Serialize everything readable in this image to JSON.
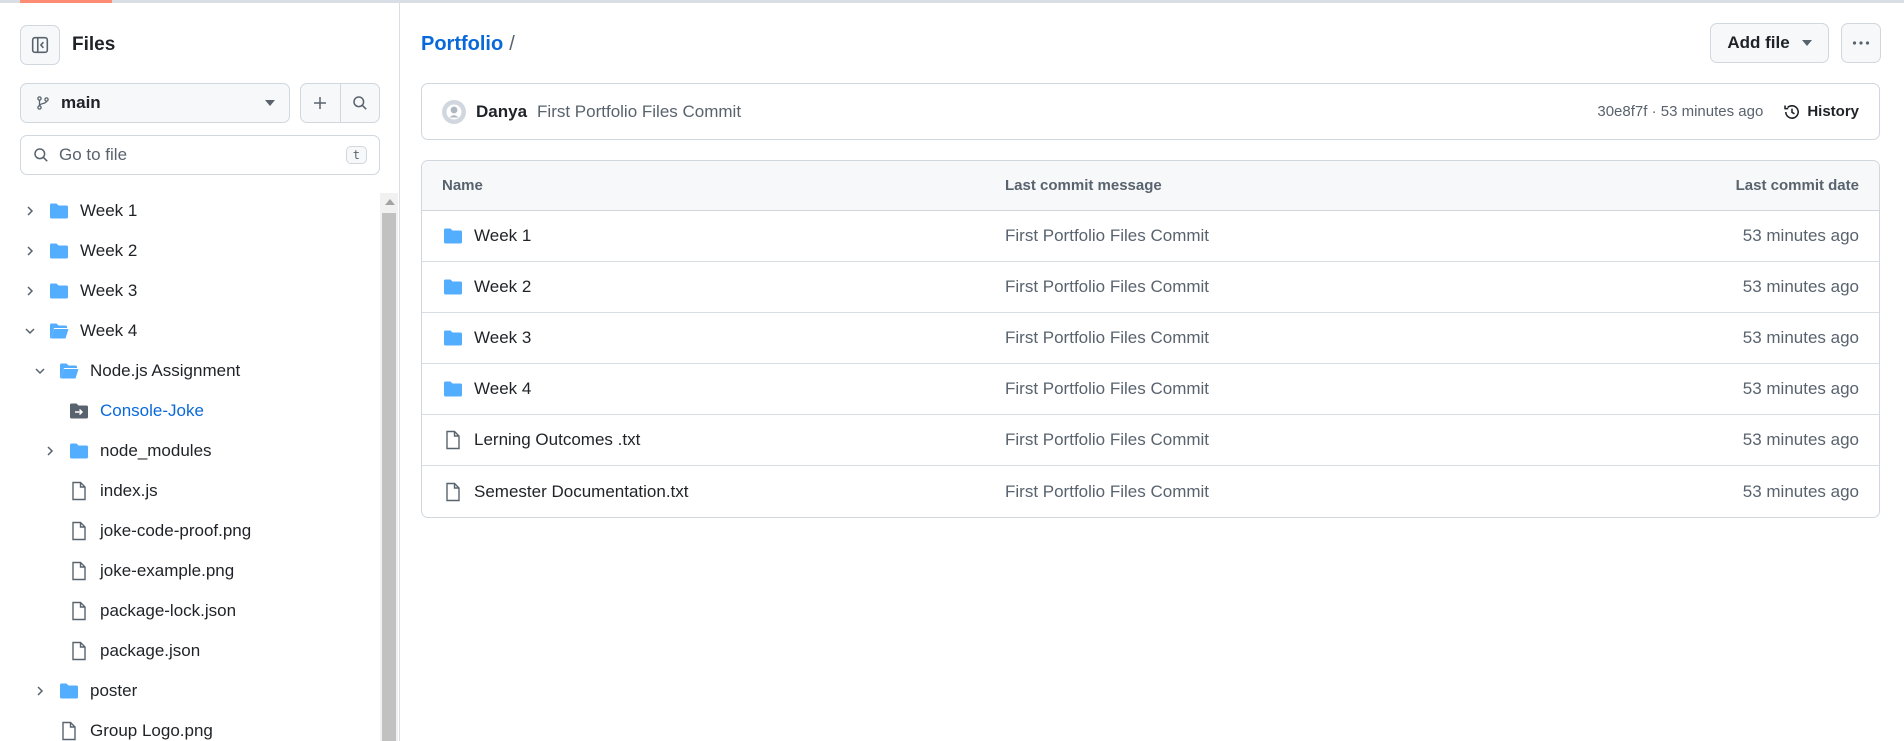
{
  "sidebar": {
    "title": "Files",
    "branch": "main",
    "goto_placeholder": "Go to file",
    "goto_shortcut": "t",
    "tree": [
      {
        "label": "Week 1",
        "type": "folder",
        "expanded": false
      },
      {
        "label": "Week 2",
        "type": "folder",
        "expanded": false
      },
      {
        "label": "Week 3",
        "type": "folder",
        "expanded": false
      },
      {
        "label": "Week 4",
        "type": "folder",
        "expanded": true
      },
      {
        "label": "Node.js Assignment",
        "type": "folder",
        "expanded": true
      },
      {
        "label": "Console-Joke",
        "type": "submodule",
        "selected": true
      },
      {
        "label": "node_modules",
        "type": "folder",
        "expanded": false
      },
      {
        "label": "index.js",
        "type": "file"
      },
      {
        "label": "joke-code-proof.png",
        "type": "file"
      },
      {
        "label": "joke-example.png",
        "type": "file"
      },
      {
        "label": "package-lock.json",
        "type": "file"
      },
      {
        "label": "package.json",
        "type": "file"
      },
      {
        "label": "poster",
        "type": "folder",
        "expanded": false
      },
      {
        "label": "Group Logo.png",
        "type": "file"
      }
    ]
  },
  "main": {
    "breadcrumb": {
      "repo": "Portfolio",
      "separator": "/"
    },
    "add_file_label": "Add file",
    "commit": {
      "author": "Danya",
      "message": "First Portfolio Files Commit",
      "meta": "30e8f7f · 53 minutes ago",
      "history_label": "History"
    },
    "table": {
      "headers": {
        "name": "Name",
        "message": "Last commit message",
        "date": "Last commit date"
      },
      "rows": [
        {
          "name": "Week 1",
          "type": "folder",
          "message": "First Portfolio Files Commit",
          "date": "53 minutes ago"
        },
        {
          "name": "Week 2",
          "type": "folder",
          "message": "First Portfolio Files Commit",
          "date": "53 minutes ago"
        },
        {
          "name": "Week 3",
          "type": "folder",
          "message": "First Portfolio Files Commit",
          "date": "53 minutes ago"
        },
        {
          "name": "Week 4",
          "type": "folder",
          "message": "First Portfolio Files Commit",
          "date": "53 minutes ago"
        },
        {
          "name": "Lerning Outcomes .txt",
          "type": "file",
          "message": "First Portfolio Files Commit",
          "date": "53 minutes ago"
        },
        {
          "name": "Semester Documentation.txt",
          "type": "file",
          "message": "First Portfolio Files Commit",
          "date": "53 minutes ago"
        }
      ]
    }
  },
  "colors": {
    "accent": "#0969da",
    "folder": "#54aeff",
    "tab_indicator": "#fd8c73"
  },
  "icons": [
    "sidebar-collapse-icon",
    "branch-icon",
    "plus-icon",
    "search-icon",
    "chevron-right-icon",
    "chevron-down-icon",
    "folder-icon",
    "folder-open-icon",
    "submodule-icon",
    "file-icon",
    "kebab-icon",
    "history-icon",
    "avatar-icon"
  ]
}
